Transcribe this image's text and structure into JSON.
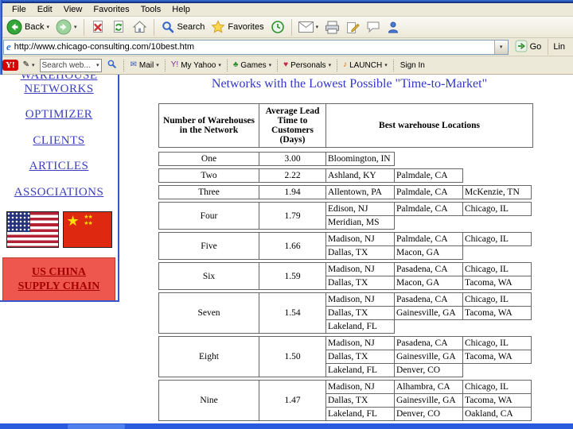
{
  "chrome": {
    "menu_items": [
      "File",
      "Edit",
      "View",
      "Favorites",
      "Tools",
      "Help"
    ],
    "toolbar": {
      "back_label": "Back",
      "search_label": "Search",
      "favorites_label": "Favorites"
    },
    "address": {
      "url": "http://www.chicago-consulting.com/10best.htm",
      "go_label": "Go",
      "links_label": "Lin"
    },
    "yahoo": {
      "logo": "Y!",
      "search_placeholder": "Search web...",
      "items": [
        {
          "label": "Mail",
          "icon": "envelope-icon"
        },
        {
          "label": "My Yahoo",
          "icon": "my-yahoo-icon"
        },
        {
          "label": "Games",
          "icon": "games-icon"
        },
        {
          "label": "Personals",
          "icon": "heart-icon"
        },
        {
          "label": "LAUNCH",
          "icon": "music-note-icon"
        }
      ],
      "sign_in": "Sign In"
    }
  },
  "sidebar": {
    "links": [
      "WAREHOUSE NETWORKS",
      "OPTIMIZER",
      "CLIENTS",
      "ARTICLES",
      "ASSOCIATIONS"
    ],
    "us_china_lines": [
      "US CHINA",
      "SUPPLY CHAIN"
    ],
    "flags": [
      "us-flag",
      "china-flag"
    ]
  },
  "main": {
    "title": "Networks with the Lowest Possible \"Time-to-Market\"",
    "table": {
      "headers": [
        "Number of Warehouses in the Network",
        "Average Lead Time to Customers (Days)",
        "Best warehouse Locations"
      ],
      "rows": [
        {
          "count": "One",
          "lead_time": "3.00",
          "location_lines": [
            [
              "Bloomington, IN"
            ]
          ]
        },
        {
          "count": "Two",
          "lead_time": "2.22",
          "location_lines": [
            [
              "Ashland, KY",
              "Palmdale, CA"
            ]
          ]
        },
        {
          "count": "Three",
          "lead_time": "1.94",
          "location_lines": [
            [
              "Allentown, PA",
              "Palmdale, CA",
              "McKenzie, TN"
            ]
          ]
        },
        {
          "count": "Four",
          "lead_time": "1.79",
          "location_lines": [
            [
              "Edison, NJ",
              "Palmdale, CA",
              "Chicago, IL"
            ],
            [
              "Meridian, MS"
            ]
          ]
        },
        {
          "count": "Five",
          "lead_time": "1.66",
          "location_lines": [
            [
              "Madison, NJ",
              "Palmdale, CA",
              "Chicago, IL"
            ],
            [
              "Dallas, TX",
              "Macon, GA"
            ]
          ]
        },
        {
          "count": "Six",
          "lead_time": "1.59",
          "location_lines": [
            [
              "Madison, NJ",
              "Pasadena, CA",
              "Chicago, IL"
            ],
            [
              "Dallas, TX",
              "Macon, GA",
              "Tacoma, WA"
            ]
          ]
        },
        {
          "count": "Seven",
          "lead_time": "1.54",
          "location_lines": [
            [
              "Madison, NJ",
              "Pasadena, CA",
              "Chicago, IL"
            ],
            [
              "Dallas, TX",
              "Gainesville, GA",
              "Tacoma, WA"
            ],
            [
              "Lakeland, FL"
            ]
          ]
        },
        {
          "count": "Eight",
          "lead_time": "1.50",
          "location_lines": [
            [
              "Madison, NJ",
              "Pasadena, CA",
              "Chicago, IL"
            ],
            [
              "Dallas, TX",
              "Gainesville, GA",
              "Tacoma, WA"
            ],
            [
              "Lakeland, FL",
              "Denver, CO"
            ]
          ]
        },
        {
          "count": "Nine",
          "lead_time": "1.47",
          "location_lines": [
            [
              "Madison, NJ",
              "Alhambra, CA",
              "Chicago, IL"
            ],
            [
              "Dallas, TX",
              "Gainesville, GA",
              "Tacoma, WA"
            ],
            [
              "Lakeland, FL",
              "Denver, CO",
              "Oakland, CA"
            ]
          ]
        }
      ]
    }
  },
  "colors": {
    "link_blue": "#3b3fbe",
    "title_blue": "#3036c8",
    "banner_red": "#ee574d",
    "banner_text_red": "#a50000",
    "taskbar_blue": "#2a5ade"
  }
}
